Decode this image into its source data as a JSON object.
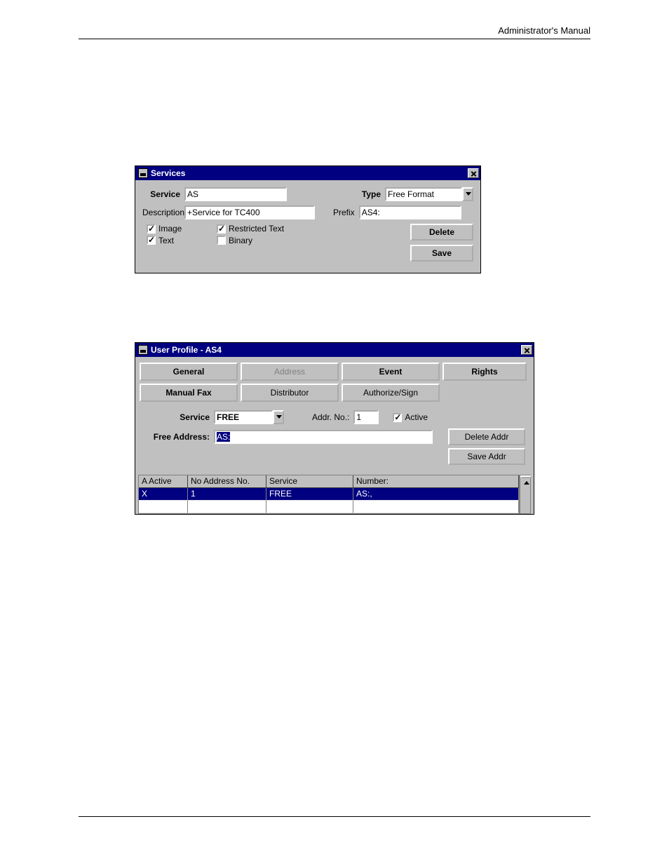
{
  "header": {
    "title": "Administrator's Manual"
  },
  "services": {
    "title": "Services",
    "service_label": "Service",
    "service_value": "AS",
    "type_label": "Type",
    "type_value": "Free Format",
    "desc_label": "Description",
    "desc_value": "+Service for TC400",
    "prefix_label": "Prefix",
    "prefix_value": "AS4:",
    "cb_image": "Image",
    "cb_text": "Text",
    "cb_restricted": "Restricted Text",
    "cb_binary": "Binary",
    "btn_delete": "Delete",
    "btn_save": "Save"
  },
  "profile": {
    "title": "User Profile - AS4",
    "tabs": {
      "general": "General",
      "address": "Address",
      "event": "Event",
      "rights": "Rights",
      "manual_fax": "Manual Fax",
      "distributor": "Distributor",
      "authorize": "Authorize/Sign"
    },
    "service_label": "Service",
    "service_value": "FREE",
    "addr_no_label": "Addr. No.:",
    "addr_no_value": "1",
    "active_label": "Active",
    "free_addr_label": "Free Address:",
    "free_addr_value": "AS:",
    "btn_delete_addr": "Delete Addr",
    "btn_save_addr": "Save Addr",
    "table": {
      "headers": [
        "A Active",
        "No Address No.",
        "Service",
        "Number:"
      ],
      "row": {
        "active": "X",
        "no": "1",
        "service": "FREE",
        "number": "AS:,"
      }
    }
  }
}
